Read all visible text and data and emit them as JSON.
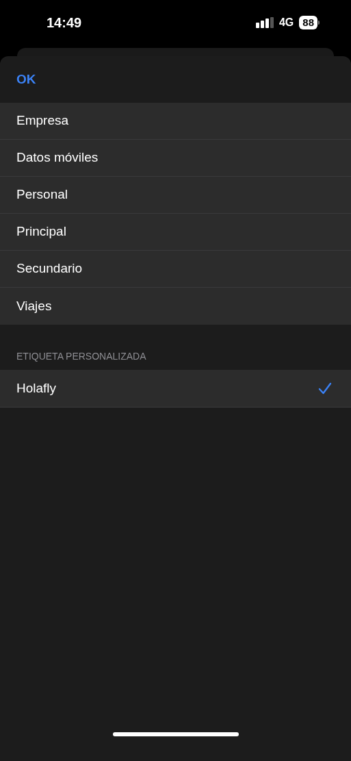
{
  "status_bar": {
    "time": "14:49",
    "network": "4G",
    "battery": "88"
  },
  "sheet": {
    "done_button": "OK"
  },
  "labels": [
    {
      "label": "Empresa",
      "selected": false
    },
    {
      "label": "Datos móviles",
      "selected": false
    },
    {
      "label": "Personal",
      "selected": false
    },
    {
      "label": "Principal",
      "selected": false
    },
    {
      "label": "Secundario",
      "selected": false
    },
    {
      "label": "Viajes",
      "selected": false
    }
  ],
  "custom_section": {
    "header": "ETIQUETA PERSONALIZADA",
    "items": [
      {
        "label": "Holafly",
        "selected": true
      }
    ]
  }
}
